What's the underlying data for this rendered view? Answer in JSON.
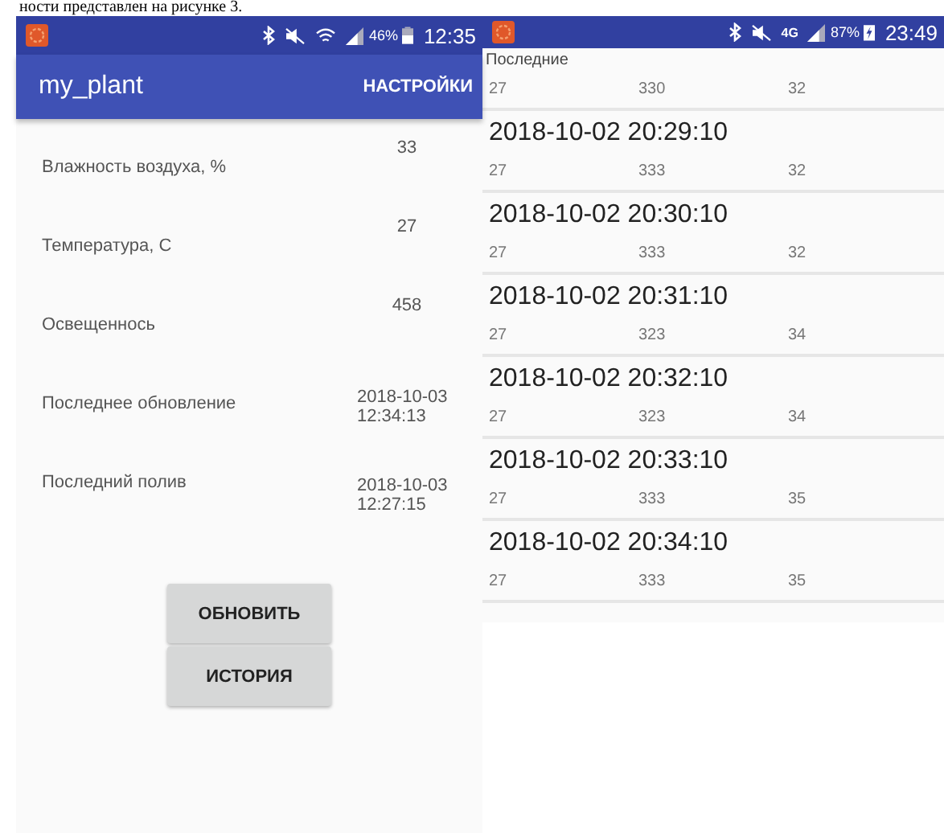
{
  "caption": "ности представлен на рисунке 3.",
  "left_screen": {
    "status_bar": {
      "battery": "46%",
      "time": "12:35"
    },
    "app_bar": {
      "title": "my_plant",
      "action": "НАСТРОЙКИ"
    },
    "readings": [
      {
        "label": "Влажность воздуха, %",
        "value": "33"
      },
      {
        "label": "Температура, С",
        "value": "27"
      },
      {
        "label": "Освещеннось",
        "value": "458"
      },
      {
        "label": "Последнее обновление",
        "value": "2018-10-03 12:34:13"
      },
      {
        "label": "Последний полив",
        "value": "2018-10-03 12:27:15"
      }
    ],
    "buttons": [
      "ОБНОВИТЬ",
      "ИСТОРИЯ"
    ]
  },
  "right_screen": {
    "status_bar": {
      "network": "4G",
      "battery": "87%",
      "time": "23:49"
    },
    "header": "Последние",
    "records": [
      {
        "values": [
          "27",
          "330",
          "32"
        ]
      },
      {
        "timestamp": "2018-10-02 20:29:10",
        "values": [
          "27",
          "333",
          "32"
        ]
      },
      {
        "timestamp": "2018-10-02 20:30:10",
        "values": [
          "27",
          "333",
          "32"
        ]
      },
      {
        "timestamp": "2018-10-02 20:31:10",
        "values": [
          "27",
          "323",
          "34"
        ]
      },
      {
        "timestamp": "2018-10-02 20:32:10",
        "values": [
          "27",
          "323",
          "34"
        ]
      },
      {
        "timestamp": "2018-10-02 20:33:10",
        "values": [
          "27",
          "333",
          "35"
        ]
      },
      {
        "timestamp": "2018-10-02 20:34:10",
        "values": [
          "27",
          "333",
          "35"
        ]
      }
    ]
  }
}
